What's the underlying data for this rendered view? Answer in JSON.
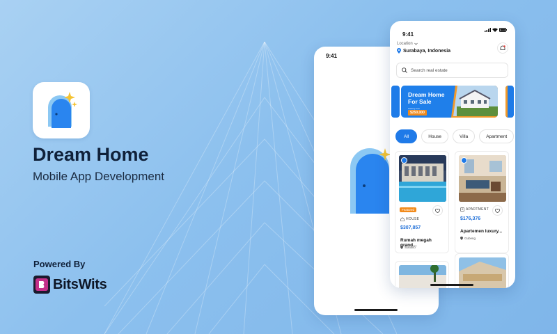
{
  "hero": {
    "title": "Dream Home",
    "subtitle": "Mobile App Development",
    "powered_by": "Powered By",
    "brand_name": "BitsWits"
  },
  "back_phone": {
    "time": "9:41"
  },
  "front_phone": {
    "time": "9:41",
    "location_label": "Location",
    "location_value": "Surabaya, Indonesia",
    "search_placeholder": "Search real estate",
    "banner": {
      "title": "Dream Home For Sale",
      "small": "Starting from",
      "price": "$250,000"
    },
    "chips": [
      "All",
      "House",
      "Villa",
      "Apartment"
    ],
    "cards": [
      {
        "badge": "Featured",
        "type": "HOUSE",
        "price": "$307,857",
        "name": "Rumah megah grand...",
        "place": "Sukolilo"
      },
      {
        "type": "APARTMENT",
        "price": "$176,376",
        "name": "Apartemen luxury...",
        "place": "Gubeng"
      }
    ]
  },
  "colors": {
    "accent": "#1f7ae8",
    "orange": "#f28a1a",
    "brand_logo": "#c42f8a"
  }
}
